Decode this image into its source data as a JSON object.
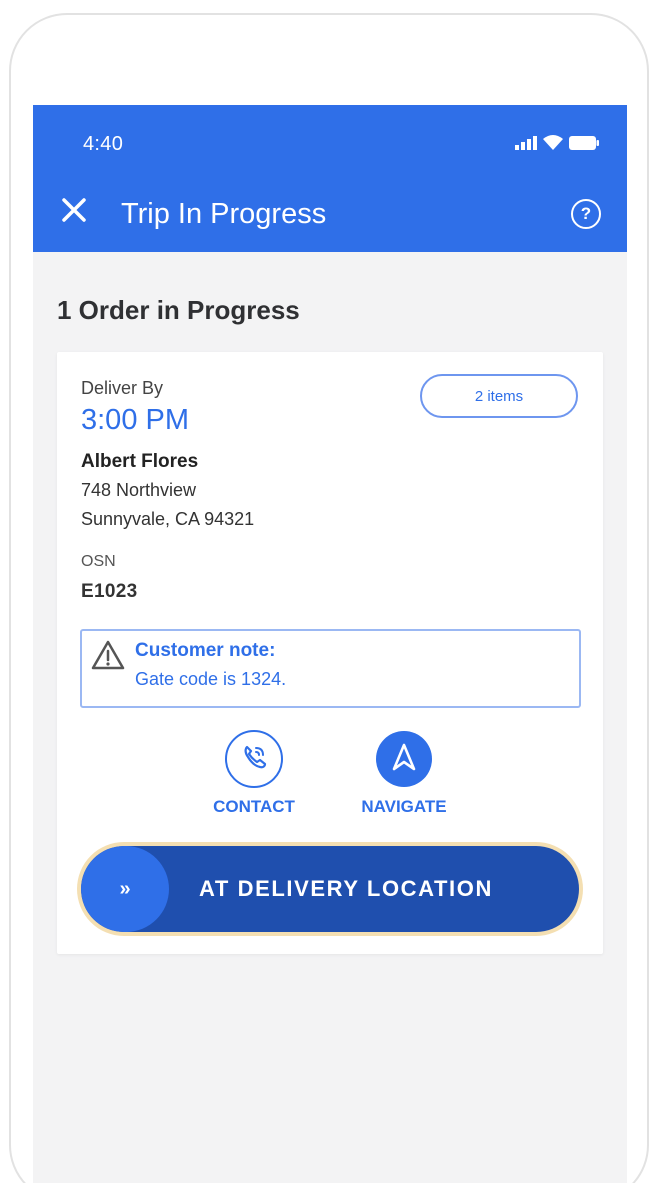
{
  "status_bar": {
    "time": "4:40"
  },
  "app_bar": {
    "title": "Trip In Progress",
    "help_glyph": "?"
  },
  "summary": {
    "title": "1 Order in Progress"
  },
  "order": {
    "deliver_by_label": "Deliver By",
    "deliver_by_time": "3:00 PM",
    "items_badge": "2 items",
    "customer_name": "Albert Flores",
    "address_line1": "748 Northview",
    "address_line2": "Sunnyvale, CA 94321",
    "osn_label": "OSN",
    "osn_value": "E1023",
    "note_title": "Customer note:",
    "note_text": "Gate code is 1324."
  },
  "actions": {
    "contact_label": "CONTACT",
    "navigate_label": "NAVIGATE"
  },
  "swipe_button": {
    "thumb_glyph": "»",
    "label": "AT DELIVERY LOCATION"
  },
  "colors": {
    "brand_blue": "#2f6fe8",
    "dark_blue": "#1f4fae",
    "background": "#f3f3f4",
    "swipe_glow": "#f4dfb2"
  },
  "icons": [
    "close-icon",
    "help-icon",
    "signal-icon",
    "wifi-icon",
    "battery-icon",
    "warning-icon",
    "phone-icon",
    "navigate-icon",
    "chevron-double-right-icon"
  ]
}
